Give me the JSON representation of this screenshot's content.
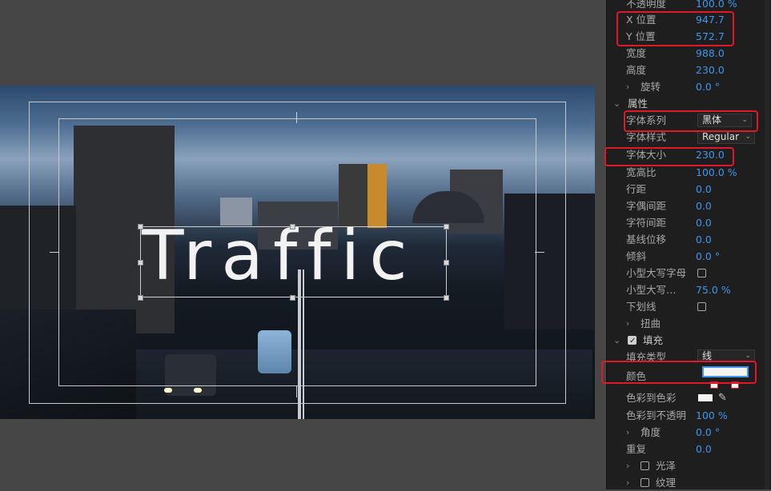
{
  "properties": {
    "opacity": {
      "label": "不透明度",
      "value": "100.0",
      "unit": "%"
    },
    "x_pos": {
      "label": "X 位置",
      "value": "947.7"
    },
    "y_pos": {
      "label": "Y 位置",
      "value": "572.7"
    },
    "width": {
      "label": "宽度",
      "value": "988.0"
    },
    "height": {
      "label": "高度",
      "value": "230.0"
    },
    "rotation": {
      "label": "旋转",
      "value": "0.0",
      "unit": "°"
    },
    "attributes_section": "属性",
    "font_family": {
      "label": "字体系列",
      "value": "黑体"
    },
    "font_style": {
      "label": "字体样式",
      "value": "Regular"
    },
    "font_size": {
      "label": "字体大小",
      "value": "230.0"
    },
    "aspect": {
      "label": "宽高比",
      "value": "100.0",
      "unit": "%"
    },
    "leading": {
      "label": "行距",
      "value": "0.0"
    },
    "kerning": {
      "label": "字偶间距",
      "value": "0.0"
    },
    "tracking": {
      "label": "字符间距",
      "value": "0.0"
    },
    "baseline": {
      "label": "基线位移",
      "value": "0.0"
    },
    "slant": {
      "label": "倾斜",
      "value": "0.0",
      "unit": "°"
    },
    "small_caps": {
      "label": "小型大写字母"
    },
    "small_caps_size": {
      "label": "小型大写…",
      "value": "75.0",
      "unit": "%"
    },
    "underline": {
      "label": "下划线"
    },
    "distort": {
      "label": "扭曲"
    },
    "fill_section": "填充",
    "fill_type": {
      "label": "填充类型",
      "value": "线"
    },
    "color": {
      "label": "颜色",
      "value": "#f4f4f4"
    },
    "color_to_color": {
      "label": "色彩到色彩"
    },
    "color_to_opacity": {
      "label": "色彩到不透明",
      "value": "100",
      "unit": "%"
    },
    "angle": {
      "label": "角度",
      "value": "0.0",
      "unit": "°"
    },
    "repeat": {
      "label": "重复",
      "value": "0.0"
    },
    "sheen": {
      "label": "光泽"
    },
    "texture": {
      "label": "纹理"
    }
  },
  "viewer": {
    "title_text": "Traffic"
  },
  "colors": {
    "accent_value": "#3f96ea",
    "highlight": "#e0192a",
    "panel_bg": "#1e1e1e"
  }
}
